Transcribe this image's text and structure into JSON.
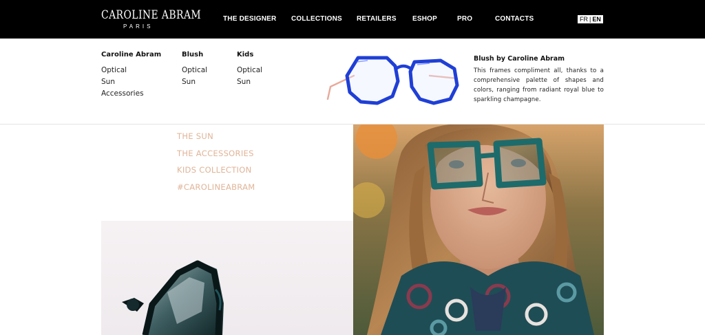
{
  "brand": {
    "name": "CAROLINE ABRAM",
    "city": "PARIS"
  },
  "nav": {
    "items": [
      "THE DESIGNER",
      "COLLECTIONS",
      "RETAILERS",
      "ESHOP",
      "PRO",
      "CONTACTS"
    ]
  },
  "language": {
    "fr": "FR",
    "separator": "|",
    "en": "EN",
    "active": "EN"
  },
  "dropdown": {
    "columns": [
      {
        "title": "Caroline Abram",
        "links": [
          "Optical",
          "Sun",
          "Accessories"
        ]
      },
      {
        "title": "Blush",
        "links": [
          "Optical",
          "Sun"
        ]
      },
      {
        "title": "Kids",
        "links": [
          "Optical",
          "Sun"
        ]
      }
    ],
    "promo": {
      "title": "Blush by Caroline Abram",
      "description": "This frames compliment all, thanks to a comprehensive palette of shapes and colors, ranging from radiant royal blue to sparkling champagne."
    }
  },
  "side_links": [
    "THE SUN",
    "THE ACCESSORIES",
    "KIDS COLLECTION",
    "#CAROLINEABRAM"
  ],
  "colors": {
    "topbar": "#000000",
    "accent_link": "#e0b498",
    "frame_blue": "#1f3fd6",
    "temple_pink": "#e8a99a",
    "teal_frame": "#1e6b6b"
  }
}
